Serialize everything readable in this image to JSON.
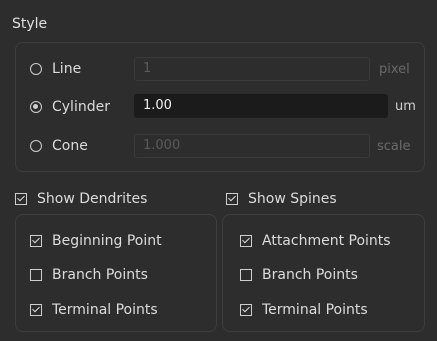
{
  "style": {
    "title": "Style",
    "options": [
      {
        "label": "Line",
        "value": "1",
        "unit": "pixel",
        "selected": false
      },
      {
        "label": "Cylinder",
        "value": "1.00",
        "unit": "um",
        "selected": true
      },
      {
        "label": "Cone",
        "value": "1.000",
        "unit": "scale",
        "selected": false
      }
    ]
  },
  "dendrites": {
    "label": "Show Dendrites",
    "checked": true,
    "items": [
      {
        "label": "Beginning Point",
        "checked": true
      },
      {
        "label": "Branch Points",
        "checked": false
      },
      {
        "label": "Terminal Points",
        "checked": true
      }
    ]
  },
  "spines": {
    "label": "Show Spines",
    "checked": true,
    "items": [
      {
        "label": "Attachment Points",
        "checked": true
      },
      {
        "label": "Branch Points",
        "checked": false
      },
      {
        "label": "Terminal Points",
        "checked": true
      }
    ]
  }
}
